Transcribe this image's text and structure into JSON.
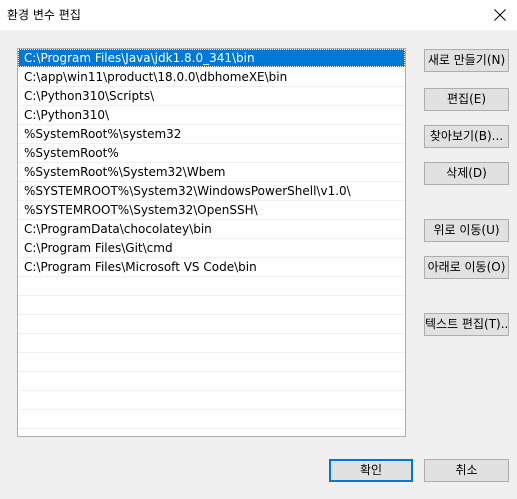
{
  "window": {
    "title": "환경 변수 편집",
    "close_icon": "close-icon"
  },
  "paths": [
    "C:\\Program Files\\Java\\jdk1.8.0_341\\bin",
    "C:\\app\\win11\\product\\18.0.0\\dbhomeXE\\bin",
    "C:\\Python310\\Scripts\\",
    "C:\\Python310\\",
    "%SystemRoot%\\system32",
    "%SystemRoot%",
    "%SystemRoot%\\System32\\Wbem",
    "%SYSTEMROOT%\\System32\\WindowsPowerShell\\v1.0\\",
    "%SYSTEMROOT%\\System32\\OpenSSH\\",
    "C:\\ProgramData\\chocolatey\\bin",
    "C:\\Program Files\\Git\\cmd",
    "C:\\Program Files\\Microsoft VS Code\\bin"
  ],
  "selected_index": 0,
  "buttons": {
    "new": "새로 만들기(N)",
    "edit": "편집(E)",
    "browse": "찾아보기(B)...",
    "delete": "삭제(D)",
    "move_up": "위로 이동(U)",
    "move_down": "아래로 이동(O)",
    "edit_text": "텍스트 편집(T)...",
    "ok": "확인",
    "cancel": "취소"
  },
  "colors": {
    "selection": "#0078d7",
    "dialog_bg": "#f0f0f0",
    "button_bg": "#e1e1e1"
  }
}
